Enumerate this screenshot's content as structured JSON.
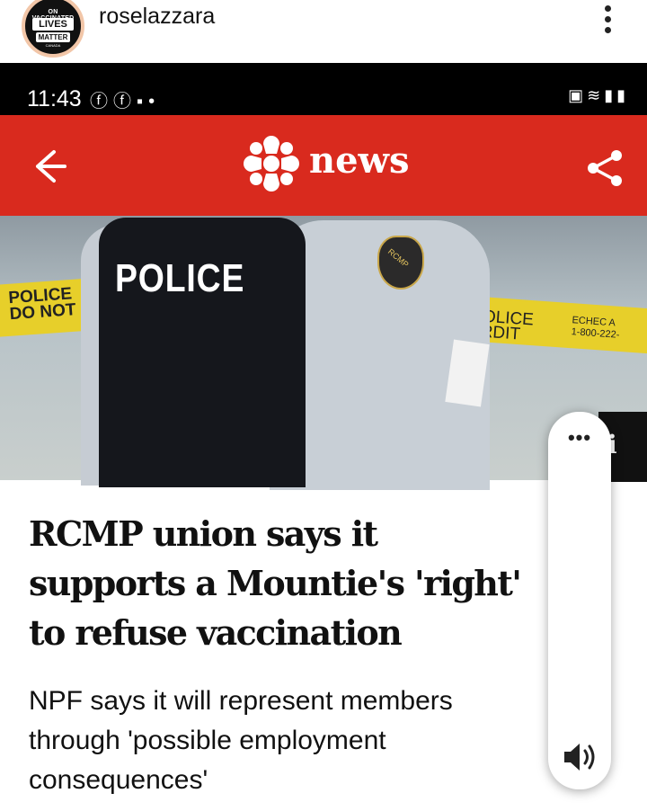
{
  "instagram": {
    "username": "roselazzara",
    "avatar": {
      "line1": "ON VACCINATED",
      "line2": "LIVES",
      "line3": "MATTER",
      "line4": "CANADA"
    }
  },
  "status_bar": {
    "time": "11:43",
    "left_icons": [
      "facebook-icon",
      "facebook-icon",
      "chat-icon",
      "dot-icon"
    ],
    "right_icons": [
      "lock-icon",
      "wifi-icon",
      "signal-icon",
      "battery-icon"
    ]
  },
  "cbc_header": {
    "brand": "news",
    "color": "#d92a1e"
  },
  "hero_image": {
    "vest_text": "POLICE",
    "tape_left": [
      "POLICE",
      "DO NOT C"
    ],
    "tape_right": [
      "DE POLICE",
      "INTERDIT"
    ],
    "tape_right_small": [
      "ECHEC A",
      "1-800-222-"
    ],
    "patch_text": "RCMP"
  },
  "article": {
    "headline": "RCMP union says it supports a Mountie's 'right' to refuse vaccination",
    "subhead": "NPF says it will represent members through 'possible employment consequences'"
  },
  "side_panel": {
    "menu": "•••",
    "peek_text": "i"
  }
}
